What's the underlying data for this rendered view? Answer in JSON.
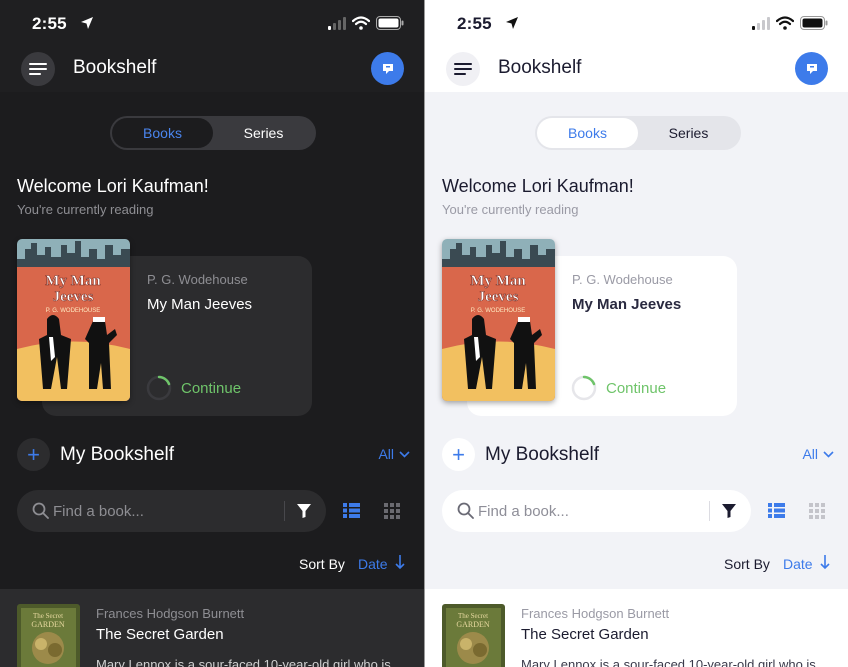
{
  "status_bar": {
    "time": "2:55"
  },
  "header": {
    "title": "Bookshelf"
  },
  "segments": {
    "books": "Books",
    "series": "Series",
    "active": "Books"
  },
  "welcome": {
    "greeting": "Welcome Lori Kaufman!",
    "subtitle": "You're currently reading"
  },
  "current_book": {
    "author": "P. G. Wodehouse",
    "title": "My Man Jeeves",
    "action": "Continue",
    "cover_title_line1": "My Man",
    "cover_title_line2": "Jeeves",
    "cover_author": "P. G. WODEHOUSE"
  },
  "bookshelf": {
    "title": "My Bookshelf",
    "filter": "All",
    "search_placeholder": "Find a book...",
    "sort_label": "Sort By",
    "sort_value": "Date"
  },
  "book_list": [
    {
      "author": "Frances Hodgson Burnett",
      "title": "The Secret Garden",
      "description": "Mary Lennox is a sour-faced 10-year-old girl who is",
      "cover_text_line1": "The Secret",
      "cover_text_line2": "GARDEN"
    }
  ],
  "colors": {
    "accent": "#3d7bea",
    "continue": "#6fc46a",
    "dark_bg": "#1c1c1e",
    "light_bg": "#f2f3f7"
  },
  "icons": [
    "location-arrow-icon",
    "cellular-signal-icon",
    "wifi-icon",
    "battery-icon",
    "hamburger-menu-icon",
    "chat-icon",
    "plus-icon",
    "chevron-down-icon",
    "search-icon",
    "filter-funnel-icon",
    "list-view-icon",
    "grid-view-icon",
    "arrow-down-icon"
  ]
}
